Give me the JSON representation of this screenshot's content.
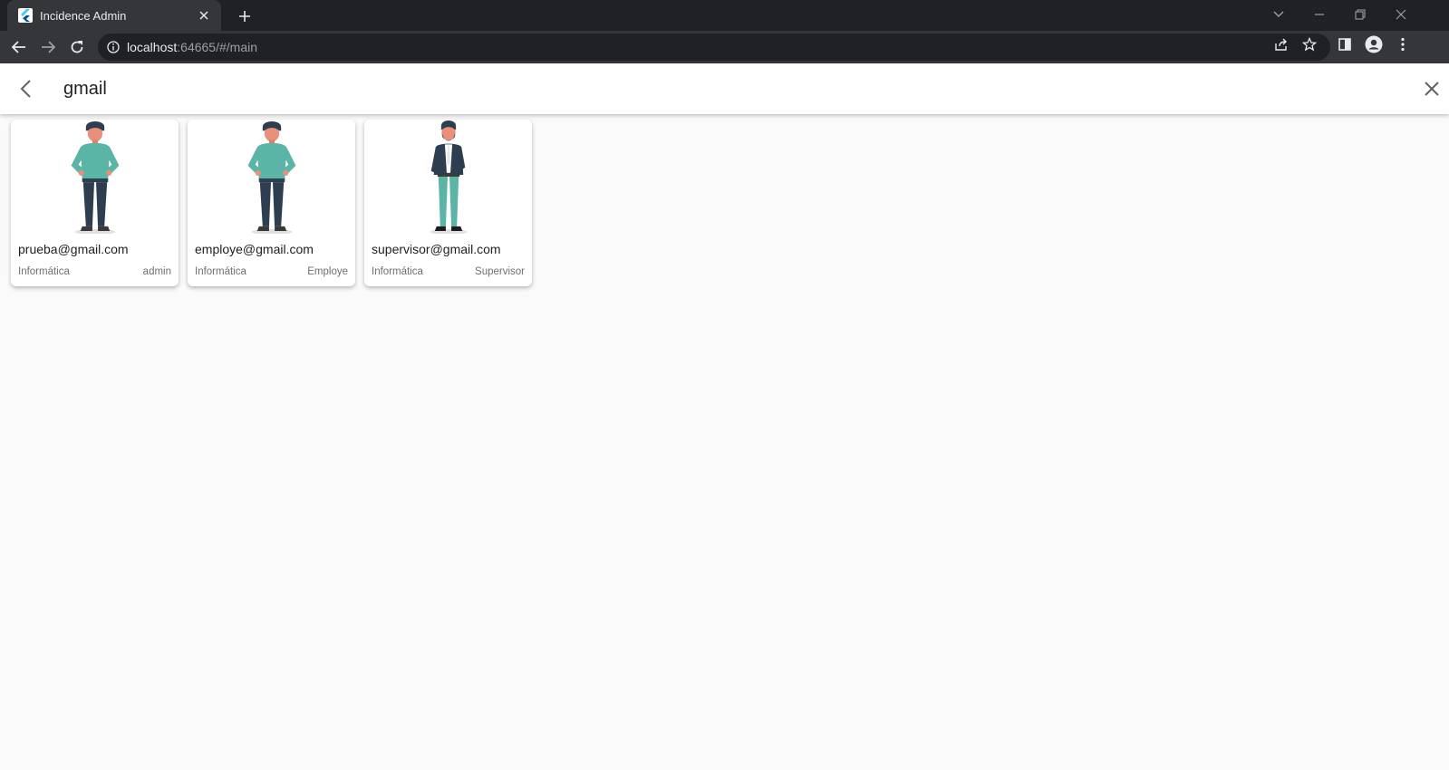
{
  "browser": {
    "tab_title": "Incidence Admin",
    "url_host": "localhost",
    "url_rest": ":64665/#/main"
  },
  "appbar": {
    "search_value": "gmail",
    "icons": {
      "back": "arrow-back-icon",
      "clear": "close-icon"
    }
  },
  "users": [
    {
      "email": "prueba@gmail.com",
      "department": "Informática",
      "role": "admin",
      "avatar": "casual-man-illustration"
    },
    {
      "email": "employe@gmail.com",
      "department": "Informática",
      "role": "Employe",
      "avatar": "casual-man-illustration"
    },
    {
      "email": "supervisor@gmail.com",
      "department": "Informática",
      "role": "Supervisor",
      "avatar": "suit-man-illustration"
    }
  ],
  "colors": {
    "chrome_dark": "#202124",
    "chrome_toolbar": "#35363a",
    "accent_teal": "#5bb5a6",
    "navy": "#2d3e50"
  }
}
